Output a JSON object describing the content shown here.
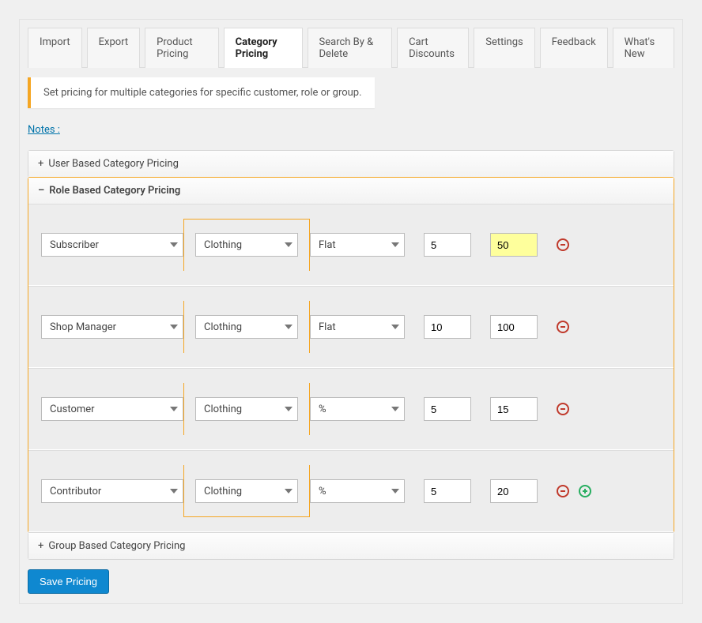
{
  "tabs": [
    "Import",
    "Export",
    "Product Pricing",
    "Category Pricing",
    "Search By & Delete",
    "Cart Discounts",
    "Settings",
    "Feedback",
    "What's New"
  ],
  "active_tab": 3,
  "info": "Set pricing for multiple categories for specific customer, role or group.",
  "notes_label": "Notes :",
  "sections": {
    "user": "User Based Category Pricing",
    "role": "Role Based Category Pricing",
    "group": "Group Based Category Pricing"
  },
  "rows": [
    {
      "role": "Subscriber",
      "category": "Clothing",
      "type": "Flat",
      "qty": "5",
      "price": "50",
      "price_hl": true,
      "add": false
    },
    {
      "role": "Shop Manager",
      "category": "Clothing",
      "type": "Flat",
      "qty": "10",
      "price": "100",
      "price_hl": false,
      "add": false
    },
    {
      "role": "Customer",
      "category": "Clothing",
      "type": "%",
      "qty": "5",
      "price": "15",
      "price_hl": false,
      "add": false
    },
    {
      "role": "Contributor",
      "category": "Clothing",
      "type": "%",
      "qty": "5",
      "price": "20",
      "price_hl": false,
      "add": true
    }
  ],
  "save_label": "Save Pricing"
}
